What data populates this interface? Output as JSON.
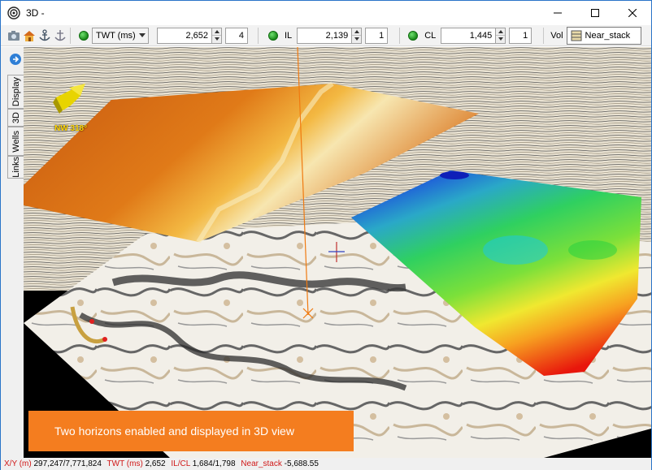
{
  "window": {
    "title": "3D -"
  },
  "toolbar": {
    "time": {
      "mode": "TWT (ms)",
      "value": "2,652",
      "step": "4"
    },
    "inline": {
      "label": "IL",
      "value": "2,139",
      "step": "1"
    },
    "crossline": {
      "label": "CL",
      "value": "1,445",
      "step": "1"
    },
    "volume": {
      "label": "Vol",
      "value": "Near_stack"
    }
  },
  "sidebar": {
    "tabs": [
      "Display",
      "3D",
      "Wells",
      "Links"
    ]
  },
  "viewport": {
    "compass_label": "NW 318°",
    "caption": "Two  horizons enabled and displayed in 3D view"
  },
  "status": {
    "xy_key": "X/Y (m)",
    "xy_val": "297,247/7,771,824",
    "twt_key": "TWT (ms)",
    "twt_val": "2,652",
    "ilcl_key": "IL/CL",
    "ilcl_val": "1,684/1,798",
    "vol_key": "Near_stack",
    "vol_val": "-5,688.55"
  },
  "colors": {
    "accent": "#f47d1f",
    "frame": "#2a74c8",
    "status_key": "#d01818"
  },
  "icons": [
    "app-icon",
    "camera-icon",
    "home-icon",
    "anchor-icon",
    "anchor-alt-icon",
    "minimize-icon",
    "maximize-icon",
    "close-icon"
  ]
}
